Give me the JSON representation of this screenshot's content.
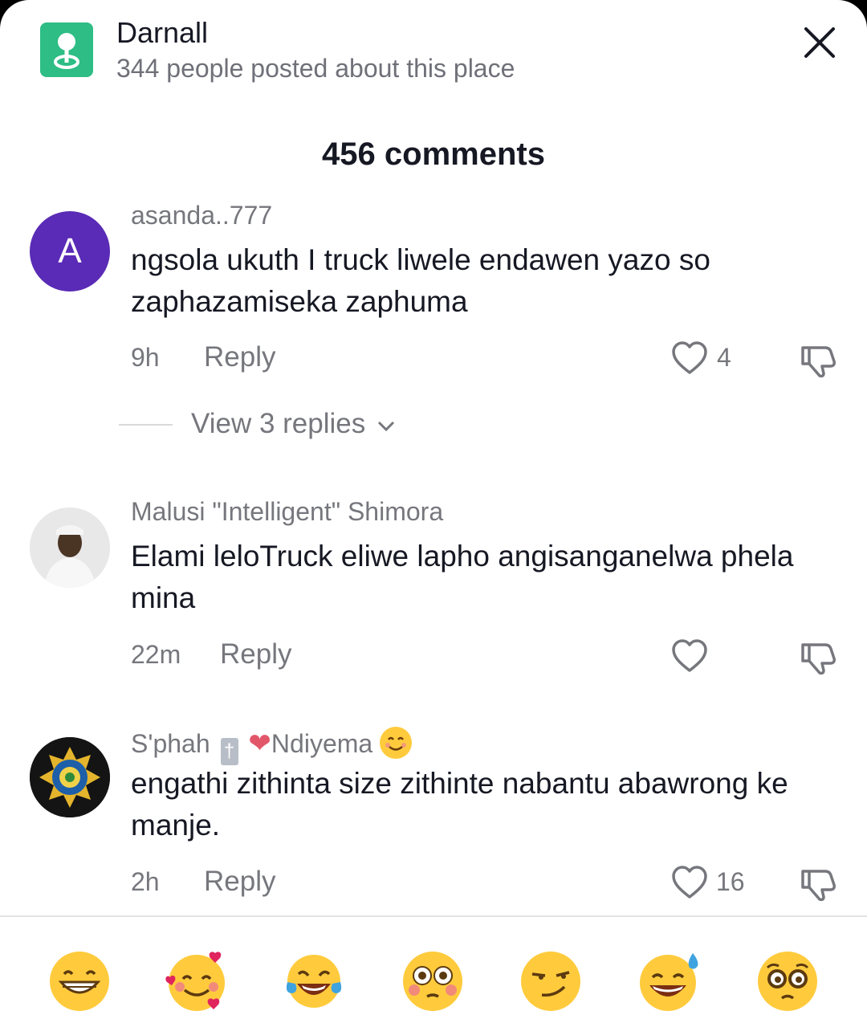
{
  "location": {
    "name": "Darnall",
    "subtitle": "344 people posted about this place",
    "icon": "map-pin-icon",
    "color": "#2dbd85"
  },
  "comments_header": "456 comments",
  "comments": [
    {
      "avatar_letter": "A",
      "avatar_color": "#5a2bb6",
      "username": "asanda..777",
      "text": "ngsola ukuth I truck liwele endawen yazo so zaphazamiseka zaphuma",
      "time": "9h",
      "reply_label": "Reply",
      "likes": "4",
      "view_replies": "View 3 replies"
    },
    {
      "username": "Malusi  \"Intelligent\" Shimora",
      "text": "Elami leloTruck eliwe lapho angisanganelwa phela mina",
      "time": "22m",
      "reply_label": "Reply",
      "likes": ""
    },
    {
      "username": "S'phah",
      "username_suffix": "Ndiyema",
      "text": "engathi zithinta size zithinte nabantu abawrong ke manje.",
      "time": "2h",
      "reply_label": "Reply",
      "likes": "16"
    }
  ],
  "emoji_bar": [
    "grinning-face",
    "smiling-face-with-hearts",
    "face-with-tears-of-joy",
    "flushed-face",
    "smirking-face",
    "grinning-face-with-sweat",
    "pleading-face"
  ]
}
